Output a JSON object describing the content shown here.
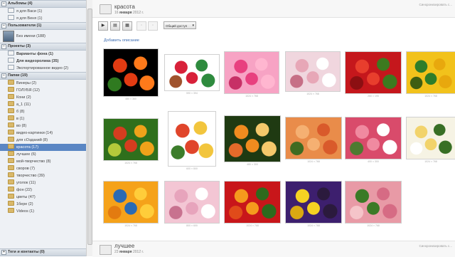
{
  "sidebar": {
    "albums": {
      "title": "Альбомы (4)",
      "items": [
        {
          "label": "я для Васи (1)",
          "icon": "page"
        },
        {
          "label": "я для Веня (1)",
          "icon": "page"
        }
      ]
    },
    "users": {
      "title": "Пользователи (1)",
      "items": [
        {
          "label": "Без имени (188)",
          "icon": "avatar"
        }
      ]
    },
    "projects": {
      "title": "Проекты (3)",
      "items": [
        {
          "label": "Варианты фона (1)",
          "icon": "page",
          "bold": true
        },
        {
          "label": "Для видеоролика (35)",
          "icon": "page",
          "bold": true
        },
        {
          "label": "Экспортированное видео (2)",
          "icon": "page",
          "bold": false
        }
      ]
    },
    "folders": {
      "title": "Папки (19)",
      "items": [
        {
          "label": "Винеры (2)",
          "selected": false
        },
        {
          "label": "ГОЛУБЯ (12)",
          "selected": false
        },
        {
          "label": "Кони (2)",
          "selected": false
        },
        {
          "label": "а_1 (11)",
          "selected": false
        },
        {
          "label": "б (8)",
          "selected": false
        },
        {
          "label": "в (1)",
          "selected": false
        },
        {
          "label": "во (8)",
          "selected": false
        },
        {
          "label": "видео-картинки (14)",
          "selected": false
        },
        {
          "label": "для сОзданий (8)",
          "selected": false
        },
        {
          "label": "красота (17)",
          "selected": true
        },
        {
          "label": "лучшее (6)",
          "selected": false
        },
        {
          "label": "мой-творчество (8)",
          "selected": false
        },
        {
          "label": "своров (7)",
          "selected": false
        },
        {
          "label": "творчество (39)",
          "selected": false
        },
        {
          "label": "уголок (11)",
          "selected": false
        },
        {
          "label": "фон (22)",
          "selected": false
        },
        {
          "label": "цветы (47)",
          "selected": false
        },
        {
          "label": "1бере (2)",
          "selected": false
        },
        {
          "label": "Videos (1)",
          "selected": false
        }
      ]
    },
    "footer": {
      "title": "Теги и контакты (0)"
    }
  },
  "album": {
    "title": "красота",
    "date_prefix": "16",
    "date_bold": "января",
    "date_suffix": "2012 г.",
    "right_label": "Синхронизировать с..."
  },
  "toolbar": {
    "play_icon": "▶",
    "b2_icon": "▤",
    "b3_icon": "▦",
    "b4_icon": "▫",
    "b5_icon": "▫",
    "access_label": "Общий доступ",
    "access_caret": "▾"
  },
  "add_link": "Добавить описание",
  "photos": [
    {
      "caption": "480 × 360",
      "colors": [
        "#000000",
        "#e23b12",
        "#ff7a1a",
        "#2f7a20"
      ]
    },
    {
      "caption": "590 × 394",
      "colors": [
        "#ffffff",
        "#d8213a",
        "#2e8b3e",
        "#a0522d"
      ]
    },
    {
      "caption": "1024 × 768",
      "colors": [
        "#f7a3c4",
        "#e8407f",
        "#ffb6d0",
        "#c73066"
      ]
    },
    {
      "caption": "1024 × 768",
      "colors": [
        "#f0d6de",
        "#e7a7b7",
        "#ffffff",
        "#c66f86"
      ]
    },
    {
      "caption": "260 × 195",
      "colors": [
        "#c5171c",
        "#e83e2d",
        "#3d7a1f",
        "#8c0f12"
      ]
    },
    {
      "caption": "1024 × 768",
      "colors": [
        "#f2c21b",
        "#2e7d2a",
        "#e8a80d",
        "#3e5e12"
      ]
    },
    {
      "caption": "1024 × 768",
      "colors": [
        "#2f6f1c",
        "#d53d1f",
        "#f0a21a",
        "#b4c93a"
      ]
    },
    {
      "caption": "600 × 800",
      "colors": [
        "#ffffff",
        "#e0452b",
        "#f2c53d",
        "#3c7d2b"
      ]
    },
    {
      "caption": "480 × 300",
      "colors": [
        "#1f3a12",
        "#f08b1f",
        "#f4c86b",
        "#e46a2a"
      ]
    },
    {
      "caption": "1024 × 768",
      "colors": [
        "#e98c4a",
        "#f5b072",
        "#d95a2b",
        "#3f6b21"
      ]
    },
    {
      "caption": "400 × 300",
      "colors": [
        "#d94b6b",
        "#f08aa0",
        "#ffffff",
        "#4d7a30"
      ]
    },
    {
      "caption": "1024 × 768",
      "colors": [
        "#f6f3e4",
        "#f2d36b",
        "#386f25",
        "#ffffff"
      ]
    },
    {
      "caption": "1024 × 768",
      "colors": [
        "#f5a21a",
        "#2b6ab3",
        "#ffcd3a",
        "#e37b10"
      ]
    },
    {
      "caption": "800 × 600",
      "colors": [
        "#f3c6d4",
        "#e7a4bc",
        "#ffffff",
        "#c8728f"
      ]
    },
    {
      "caption": "1024 × 768",
      "colors": [
        "#c8161a",
        "#f59b1d",
        "#2d6a1d",
        "#e04b1a"
      ]
    },
    {
      "caption": "1024 × 768",
      "colors": [
        "#3d1f6e",
        "#f5d222",
        "#2b1a3d",
        "#d9a812"
      ]
    },
    {
      "caption": "1024 × 768",
      "colors": [
        "#e89aa6",
        "#3b7a26",
        "#d66b84",
        "#f5c4c9"
      ]
    }
  ],
  "bottom_album": {
    "title": "лучшее",
    "date_prefix": "23",
    "date_bold": "января",
    "date_suffix": "2012 г.",
    "right_label": "Синхронизировать с..."
  }
}
